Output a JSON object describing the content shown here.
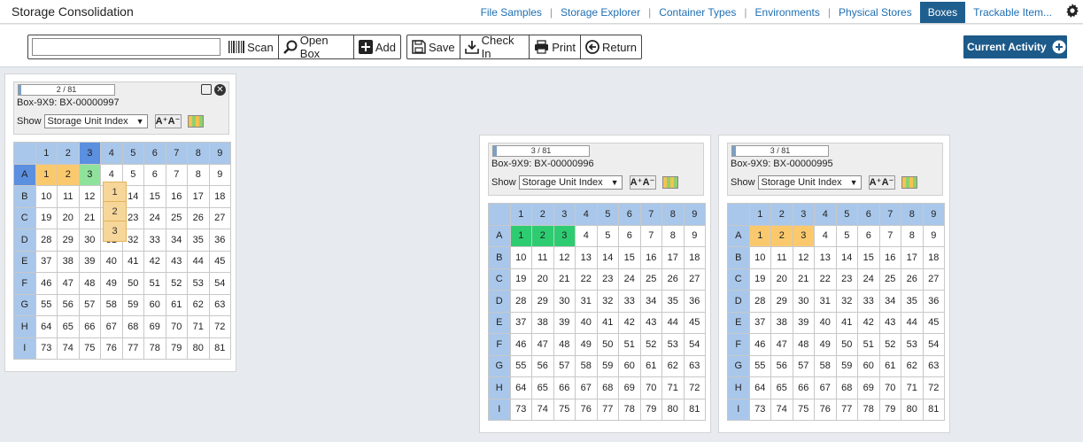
{
  "app": {
    "title": "Storage Consolidation"
  },
  "nav": [
    {
      "label": "File Samples",
      "active": false
    },
    {
      "label": "Storage Explorer",
      "active": false
    },
    {
      "label": "Container Types",
      "active": false
    },
    {
      "label": "Environments",
      "active": false
    },
    {
      "label": "Physical Stores",
      "active": false
    },
    {
      "label": "Boxes",
      "active": true
    },
    {
      "label": "Trackable Item...",
      "active": false
    }
  ],
  "toolbar": {
    "scan_value": "",
    "scan_label": "Scan",
    "open_box_label": "Open Box",
    "add_label": "Add",
    "save_label": "Save",
    "check_in_label": "Check In",
    "print_label": "Print",
    "return_label": "Return",
    "current_activity_label": "Current Activity"
  },
  "boxes": [
    {
      "progress": "2 / 81",
      "progress_fraction": 0.025,
      "name": "Box-9X9: BX-00000997",
      "show_label": "Show",
      "show_value": "Storage Unit Index",
      "columns": [
        "1",
        "2",
        "3",
        "4",
        "5",
        "6",
        "7",
        "8",
        "9"
      ],
      "rows": [
        "A",
        "B",
        "C",
        "D",
        "E",
        "F",
        "G",
        "H",
        "I"
      ],
      "selected_column": "3",
      "selected_row": "A",
      "orange": [
        1,
        2
      ],
      "green": [],
      "light_green": [
        3
      ],
      "drag_items": [
        "1",
        "2",
        "3"
      ]
    },
    {
      "progress": "3 / 81",
      "progress_fraction": 0.037,
      "name": "Box-9X9: BX-00000996",
      "show_label": "Show",
      "show_value": "Storage Unit Index",
      "columns": [
        "1",
        "2",
        "3",
        "4",
        "5",
        "6",
        "7",
        "8",
        "9"
      ],
      "rows": [
        "A",
        "B",
        "C",
        "D",
        "E",
        "F",
        "G",
        "H",
        "I"
      ],
      "selected_column": "",
      "selected_row": "",
      "orange": [],
      "green": [
        1,
        2,
        3
      ],
      "light_green": []
    },
    {
      "progress": "3 / 81",
      "progress_fraction": 0.037,
      "name": "Box-9X9: BX-00000995",
      "show_label": "Show",
      "show_value": "Storage Unit Index",
      "columns": [
        "1",
        "2",
        "3",
        "4",
        "5",
        "6",
        "7",
        "8",
        "9"
      ],
      "rows": [
        "A",
        "B",
        "C",
        "D",
        "E",
        "F",
        "G",
        "H",
        "I"
      ],
      "selected_column": "",
      "selected_row": "",
      "orange": [
        1,
        2,
        3
      ],
      "green": [],
      "light_green": []
    }
  ],
  "colors": {
    "orange": "#fbc96d",
    "green": "#2ecc71",
    "light_green": "#8fe29b",
    "header": "#a9c7ea",
    "header_selected": "#5b8fe0",
    "accent": "#1c5a8a"
  },
  "icons": {
    "settings": "gear-icon",
    "scan": "barcode-icon",
    "open_box": "magnifier-icon",
    "add": "plus-square-icon",
    "save": "floppy-icon",
    "check_in": "download-tray-icon",
    "print": "printer-icon",
    "return": "arrow-left-circle-icon",
    "current_activity": "plus-circle-icon"
  }
}
